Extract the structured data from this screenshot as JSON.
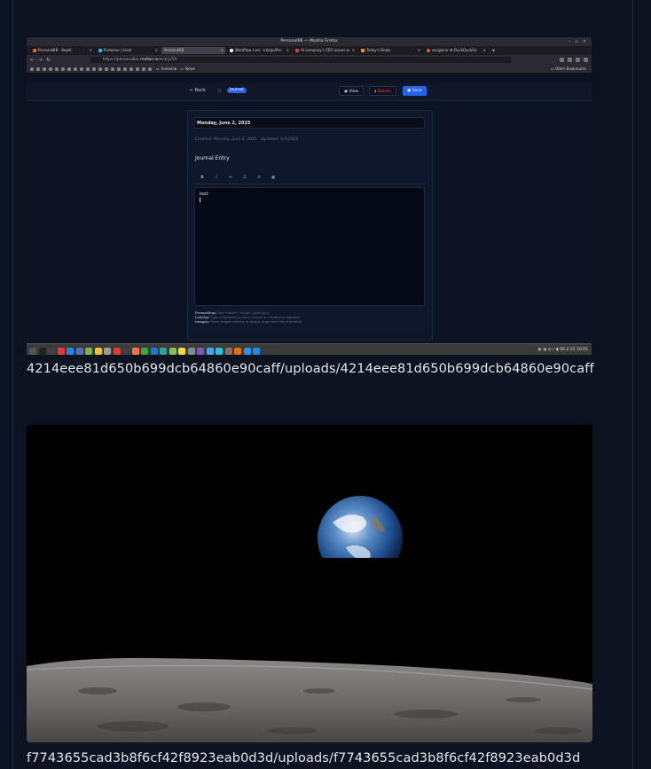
{
  "uploads": [
    {
      "caption": "4214eee81d650b699dcb64860e90caff/uploads/4214eee81d650b699dcb64860e90caff",
      "screenshot": {
        "window_title": "PersonalKB — Mozilla Firefox",
        "tabs": [
          {
            "label": "PersonalKB - Replit",
            "color": "#f26207"
          },
          {
            "label": "Portainer | local",
            "color": "#13bef9"
          },
          {
            "label": "PersonalKB",
            "color": "#6b7280",
            "active": true
          },
          {
            "label": "Workflow runs · klarge/Per",
            "color": "#ffffff"
          },
          {
            "label": "AI company's CEO issues w",
            "color": "#e53935"
          },
          {
            "label": "Today's Deals",
            "color": "#ff9900"
          },
          {
            "label": "sanguine at DuckDuckGo",
            "color": "#de5833"
          }
        ],
        "url_prefix": "https://personalkb.",
        "url_host": "melkor.io",
        "url_path": "/entry/19",
        "bookmarks": [
          "homelab",
          "News"
        ],
        "other_bookmarks": "Other Bookmarks",
        "app": {
          "back_label": "Back",
          "category_badge": "Journal",
          "view_label": "View",
          "delete_label": "Delete",
          "save_label": "Save",
          "entry_title": "Monday, June 2, 2025",
          "created": "Created: Monday, June 2, 2025",
          "updated": "Updated: 6/2/2025",
          "section_label": "Journal Entry",
          "toolbar": [
            "B",
            "I",
            "⇔",
            "☰",
            "≡",
            "▣"
          ],
          "editor_text": "test",
          "help_formatting_label": "Formatting:",
          "help_formatting": "Use **bold**, *italic*, [links](url)",
          "help_linking_label": "Linking:",
          "help_linking": "Type # followed by entry names to link entries together",
          "help_images_label": "Images:",
          "help_images": "Paste images directly or drag & drop them into the editor"
        },
        "taskbar": {
          "icon_colors": [
            "#555",
            "#222",
            "#444",
            "#e53935",
            "#1e88e5",
            "#5c6bc0",
            "#7cb342",
            "#fbc02d",
            "#9e9e9e",
            "#e53935",
            "#424242",
            "#ff7043",
            "#43a047",
            "#1976d2",
            "#26a69a",
            "#8bc34a",
            "#fdd835",
            "#78909c",
            "#7e57c2",
            "#42a5f5",
            "#26c6da",
            "#8d6e63",
            "#ef6c00",
            "#2196f3",
            "#1e88e5"
          ],
          "clock": "06-2-25 10:05"
        }
      }
    },
    {
      "caption": "f7743655cad3b8f6cf42f8923eab0d3d/uploads/f7743655cad3b8f6cf42f8923eab0d3d"
    }
  ]
}
